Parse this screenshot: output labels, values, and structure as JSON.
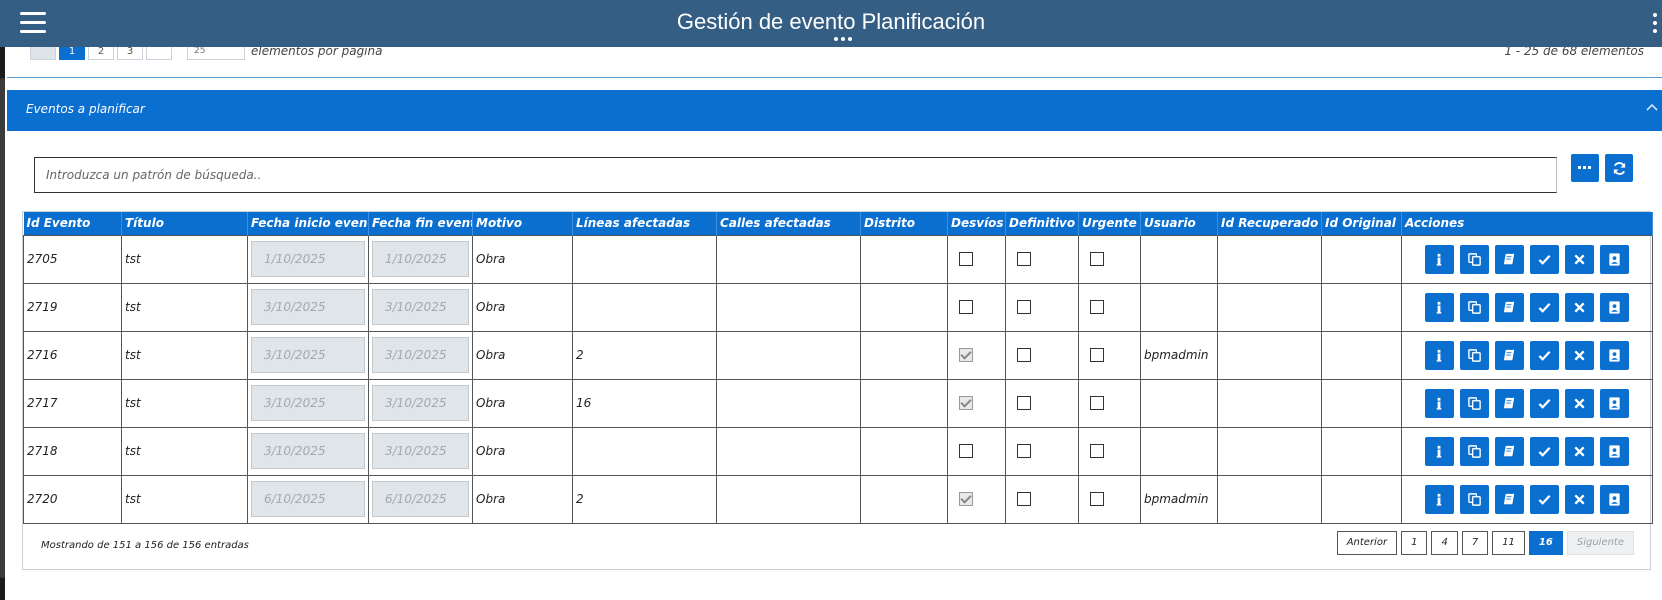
{
  "header": {
    "title": "Gestión de evento Planificación",
    "menu_icon": "hamburger-menu-icon",
    "more_icon": "kebab-more-icon"
  },
  "previous_section": {
    "pager_pages": [
      "",
      "1",
      "2",
      "3",
      ""
    ],
    "page_size_value": "25",
    "page_size_label": "elementos por página",
    "range_info": "1 - 25 de 68 elementos"
  },
  "panel": {
    "title": "Eventos a planificar",
    "collapse_icon": "chevron-up-icon"
  },
  "search": {
    "placeholder": "Introduzca un patrón de búsqueda..",
    "options_icon": "ellipsis-icon",
    "refresh_icon": "refresh-icon"
  },
  "table": {
    "columns": [
      "Id Evento",
      "Título",
      "Fecha inicio evento",
      "Fecha fin evento",
      "Motivo",
      "Líneas afectadas",
      "Calles afectadas",
      "Distrito",
      "Desvíos",
      "Definitivo",
      "Urgente",
      "Usuario",
      "Id Recuperado",
      "Id Original",
      "Acciones"
    ],
    "rows": [
      {
        "id": "2705",
        "titulo": "tst",
        "inicio": "1/10/2025",
        "fin": "1/10/2025",
        "motivo": "Obra",
        "lineas": "",
        "calles": "",
        "distrito": "",
        "desvios": false,
        "definitivo": false,
        "urgente": false,
        "usuario": "",
        "id_recuperado": "",
        "id_original": ""
      },
      {
        "id": "2719",
        "titulo": "tst",
        "inicio": "3/10/2025",
        "fin": "3/10/2025",
        "motivo": "Obra",
        "lineas": "",
        "calles": "",
        "distrito": "",
        "desvios": false,
        "definitivo": false,
        "urgente": false,
        "usuario": "",
        "id_recuperado": "",
        "id_original": ""
      },
      {
        "id": "2716",
        "titulo": "tst",
        "inicio": "3/10/2025",
        "fin": "3/10/2025",
        "motivo": "Obra",
        "lineas": "2",
        "calles": "",
        "distrito": "",
        "desvios": true,
        "definitivo": false,
        "urgente": false,
        "usuario": "bpmadmin",
        "id_recuperado": "",
        "id_original": ""
      },
      {
        "id": "2717",
        "titulo": "tst",
        "inicio": "3/10/2025",
        "fin": "3/10/2025",
        "motivo": "Obra",
        "lineas": "16",
        "calles": "",
        "distrito": "",
        "desvios": true,
        "definitivo": false,
        "urgente": false,
        "usuario": "",
        "id_recuperado": "",
        "id_original": ""
      },
      {
        "id": "2718",
        "titulo": "tst",
        "inicio": "3/10/2025",
        "fin": "3/10/2025",
        "motivo": "Obra",
        "lineas": "",
        "calles": "",
        "distrito": "",
        "desvios": false,
        "definitivo": false,
        "urgente": false,
        "usuario": "",
        "id_recuperado": "",
        "id_original": ""
      },
      {
        "id": "2720",
        "titulo": "tst",
        "inicio": "6/10/2025",
        "fin": "6/10/2025",
        "motivo": "Obra",
        "lineas": "2",
        "calles": "",
        "distrito": "",
        "desvios": true,
        "definitivo": false,
        "urgente": false,
        "usuario": "bpmadmin",
        "id_recuperado": "",
        "id_original": ""
      }
    ],
    "action_icons": [
      "info-icon",
      "copy-icon",
      "book-icon",
      "check-icon",
      "close-icon",
      "assign-user-icon"
    ]
  },
  "footer": {
    "info": "Mostrando de 151 a 156 de 156 entradas",
    "previous_label": "Anterior",
    "pages": [
      "1",
      "4",
      "7",
      "11",
      "16"
    ],
    "active_page": "16",
    "next_label": "Siguiente"
  },
  "colors": {
    "topbar": "#345e84",
    "accent": "#0b6fd0"
  }
}
